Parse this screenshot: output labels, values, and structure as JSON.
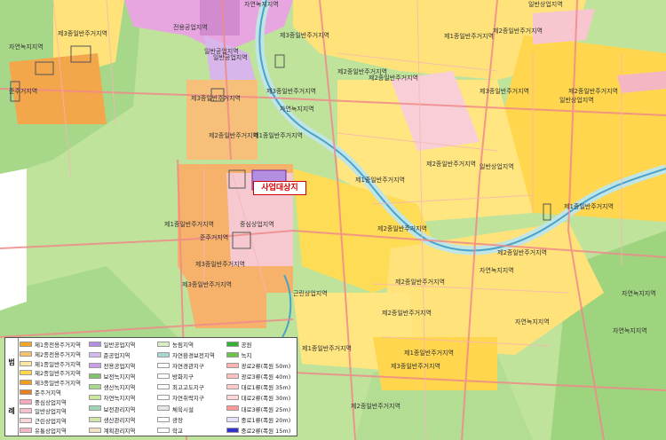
{
  "site_label": "사업대상지",
  "legend": {
    "title_chars": [
      "범",
      "례"
    ],
    "columns": [
      [
        {
          "label": "제1종전용주거지역",
          "color": "#f5a623"
        },
        {
          "label": "제2종전용주거지역",
          "color": "#f7c06a"
        },
        {
          "label": "제1종일반주거지역",
          "color": "#fde7a4"
        },
        {
          "label": "제2종일반주거지역",
          "color": "#ffd84a"
        },
        {
          "label": "제3종일반주거지역",
          "color": "#f39c1f"
        },
        {
          "label": "준주거지역",
          "color": "#e67e22"
        },
        {
          "label": "중심상업지역",
          "color": "#f6a9b8"
        },
        {
          "label": "일반상업지역",
          "color": "#f8c2cc"
        },
        {
          "label": "근린상업지역",
          "color": "#fbd3d9"
        },
        {
          "label": "유통상업지역",
          "color": "#f4b6c2"
        }
      ],
      [
        {
          "label": "일반공업지역",
          "color": "#b48ee0"
        },
        {
          "label": "준공업지역",
          "color": "#d5b8f0"
        },
        {
          "label": "전용공업지역",
          "color": "#c89ee6"
        },
        {
          "label": "보전녹지지역",
          "color": "#7fc36b"
        },
        {
          "label": "생산녹지지역",
          "color": "#a8d98e"
        },
        {
          "label": "자연녹지지역",
          "color": "#c9ea9e"
        },
        {
          "label": "보전관리지역",
          "color": "#9fd6b8"
        },
        {
          "label": "생산관리지역",
          "color": "#cfe8a8"
        },
        {
          "label": "계획관리지역",
          "color": "#f3e2c2"
        }
      ],
      [
        {
          "label": "농림지역",
          "color": "#d8eec4"
        },
        {
          "label": "자연환경보전지역",
          "color": "#a7d8d0"
        },
        {
          "label": "자연경관지구",
          "color": "#ffffff"
        },
        {
          "label": "방화지구",
          "color": "#ffffff"
        },
        {
          "label": "최고고도지구",
          "color": "#ffffff"
        },
        {
          "label": "자연취락지구",
          "color": "#ffffff"
        },
        {
          "label": "체육시설",
          "color": "#e6e6e6"
        },
        {
          "label": "광장",
          "color": "#ffffff"
        },
        {
          "label": "학교",
          "color": "#ffffff"
        }
      ],
      [
        {
          "label": "공원",
          "color": "#34b233"
        },
        {
          "label": "녹지",
          "color": "#6cc24a"
        },
        {
          "label": "광로2류(폭원 50m)",
          "color": "#ffb3b3"
        },
        {
          "label": "광로3류(폭원 40m)",
          "color": "#ffc2c2"
        },
        {
          "label": "대로1류(폭원 35m)",
          "color": "#ffcccc"
        },
        {
          "label": "대로2류(폭원 30m)",
          "color": "#ffd6d6"
        },
        {
          "label": "대로3류(폭원 25m)",
          "color": "#ff9999"
        },
        {
          "label": "중로1류(폭원 20m)",
          "color": "#e3e3ff"
        },
        {
          "label": "중로2류(폭원 15m)",
          "color": "#3333cc"
        }
      ]
    ]
  },
  "zone_labels": [
    {
      "text": "자연녹지지역"
    },
    {
      "text": "제3종일반주거지역"
    },
    {
      "text": "일반공업지역"
    },
    {
      "text": "전용공업지역"
    },
    {
      "text": "일반상업지역"
    },
    {
      "text": "제2종일반주거지역"
    },
    {
      "text": "제1종일반주거지역"
    },
    {
      "text": "자연녹지지역"
    },
    {
      "text": "준주거지역"
    },
    {
      "text": "제3종일반주거지역"
    },
    {
      "text": "제2종일반주거지역"
    },
    {
      "text": "제3종일반주거지역"
    },
    {
      "text": "제2종일반주거지역"
    },
    {
      "text": "제3종일반주거지역"
    },
    {
      "text": "제2종일반주거지역"
    },
    {
      "text": "자연녹지지역"
    },
    {
      "text": "일반공업지역"
    },
    {
      "text": "중심상업지역"
    },
    {
      "text": "준주거지역"
    },
    {
      "text": "제1종일반주거지역"
    },
    {
      "text": "제2종일반주거지역"
    },
    {
      "text": "제3종일반주거지역"
    },
    {
      "text": "제3종일반주거지역"
    },
    {
      "text": "근린상업지역"
    },
    {
      "text": "일반상업지역"
    },
    {
      "text": "제1종일반주거지역"
    },
    {
      "text": "제3종일반주거지역"
    },
    {
      "text": "제2종일반주거지역"
    },
    {
      "text": "제2종일반주거지역"
    },
    {
      "text": "제1종일반주거지역"
    },
    {
      "text": "제2종일반주거지역"
    },
    {
      "text": "자연녹지지역"
    },
    {
      "text": "일반상업지역"
    },
    {
      "text": "제2종일반주거지역"
    },
    {
      "text": "제1종일반주거지역"
    },
    {
      "text": "자연녹지지역"
    },
    {
      "text": "제2종일반주거지역"
    },
    {
      "text": "제1종일반주거지역"
    },
    {
      "text": "제3종일반주거지역"
    },
    {
      "text": "제2종일반주거지역"
    },
    {
      "text": "자연녹지지역"
    },
    {
      "text": "제1종일반주거지역"
    },
    {
      "text": "자연녹지지역"
    }
  ]
}
